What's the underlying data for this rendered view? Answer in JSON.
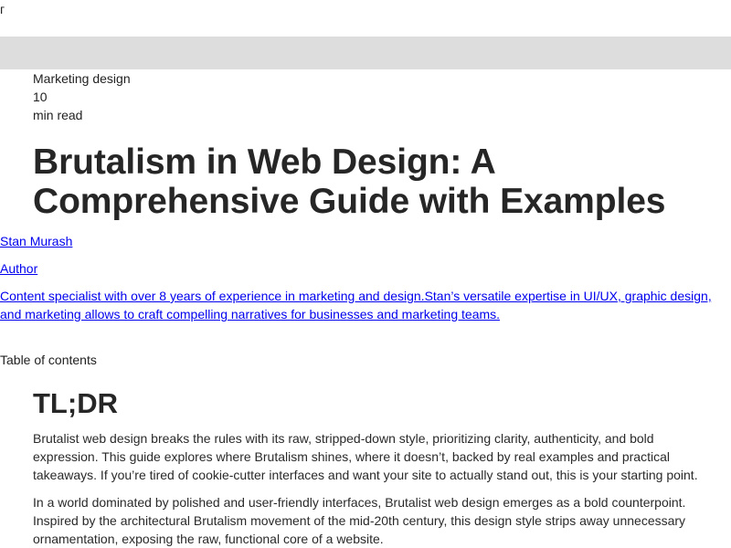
{
  "top_glyph": "г",
  "article": {
    "category": "Marketing design",
    "read_time_number": "10",
    "read_time_unit": "min read",
    "title": "Brutalism in Web Design: A Comprehensive Guide with Examples"
  },
  "author": {
    "name": "Stan Murash",
    "role": "Author",
    "bio": "Content specialist with over 8 years of experience in marketing and design.Stan’s versatile expertise in UI/UX, graphic design, and marketing allows to craft compelling narratives for businesses and marketing teams."
  },
  "toc": {
    "label": "Table of contents"
  },
  "content": {
    "tldr_heading": "TL;DR",
    "paragraphs": [
      "Brutalist web design breaks the rules with its raw, stripped-down style, prioritizing clarity, authenticity, and bold expression. This guide explores where Brutalism shines, where it doesn’t, backed by real examples and practical takeaways. If you’re tired of cookie-cutter interfaces and want your site to actually stand out, this is your starting point.",
      "In a world dominated by polished and user-friendly interfaces, Brutalist web design emerges as a bold counterpoint. Inspired by the architectural Brutalism movement of the mid-20th century, this design style strips away unnecessary ornamentation, exposing the raw, functional core of a website."
    ]
  }
}
